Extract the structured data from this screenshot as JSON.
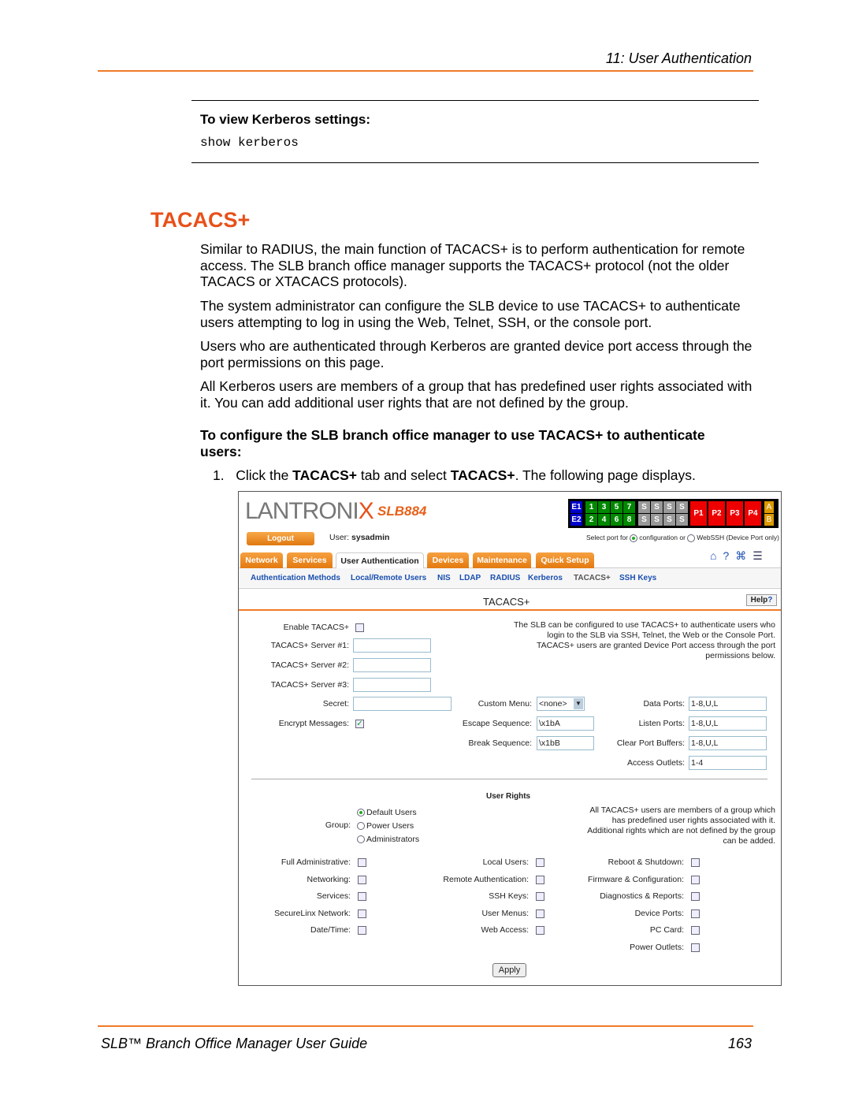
{
  "header": {
    "chapter": "11: User Authentication"
  },
  "command_box": {
    "title": "To view Kerberos settings:",
    "command": "show kerberos"
  },
  "section_title": "TACACS+",
  "paragraphs": [
    "Similar to RADIUS, the main function of TACACS+ is to perform authentication for remote access. The SLB branch office manager supports the TACACS+ protocol (not the older TACACS or XTACACS protocols).",
    "The system administrator can configure the SLB device to use TACACS+ to authenticate users attempting to log in using the Web, Telnet, SSH, or the console port.",
    "Users who are authenticated through Kerberos are granted device port access through the port permissions on this page.",
    "All Kerberos users are members of a group that has predefined user rights associated with it. You can add additional user rights that are not defined by the group."
  ],
  "procedure_heading": "To configure the SLB branch office manager to use TACACS+ to authenticate users:",
  "step": {
    "num": "1.",
    "pre": "Click the ",
    "b1": "TACACS+",
    "mid": " tab and select ",
    "b2": "TACACS+",
    "post": ". The following page displays."
  },
  "ui": {
    "logo": "LANTRONIX",
    "model": "SLB884",
    "ports": {
      "e": [
        "E1",
        "E2"
      ],
      "top": [
        "1",
        "3",
        "5",
        "7"
      ],
      "bottom": [
        "2",
        "4",
        "6",
        "8"
      ],
      "s": "S",
      "p": [
        "P1",
        "P2",
        "P3",
        "P4"
      ],
      "ab": [
        "A",
        "B"
      ]
    },
    "logout": "Logout",
    "user_label": "User:",
    "user": "sysadmin",
    "select_port": "Select port for",
    "opt_config": "configuration",
    "or": "or",
    "opt_webssh": "WebSSH (Device Port only)",
    "tabs": [
      "Network",
      "Services",
      "User Authentication",
      "Devices",
      "Maintenance",
      "Quick Setup"
    ],
    "subtabs": [
      "Authentication Methods",
      "Local/Remote Users",
      "NIS",
      "LDAP",
      "RADIUS",
      "Kerberos",
      "TACACS+",
      "SSH Keys"
    ],
    "page_title": "TACACS+",
    "help": "Help",
    "enable_label": "Enable TACACS+",
    "server1": "TACACS+ Server #1:",
    "server2": "TACACS+ Server #2:",
    "server3": "TACACS+ Server #3:",
    "secret": "Secret:",
    "encrypt": "Encrypt Messages:",
    "intro": "The SLB can be configured to use TACACS+ to authenticate users who login to the SLB via SSH, Telnet, the Web or the Console Port. TACACS+ users are granted Device Port access through the port permissions below.",
    "custom_menu": "Custom Menu:",
    "custom_menu_value": "<none>",
    "escape": "Escape Sequence:",
    "escape_value": "\\x1bA",
    "break": "Break Sequence:",
    "break_value": "\\x1bB",
    "data_ports": "Data Ports:",
    "data_ports_value": "1-8,U,L",
    "listen_ports": "Listen Ports:",
    "listen_ports_value": "1-8,U,L",
    "clear_buffers": "Clear Port Buffers:",
    "clear_buffers_value": "1-8,U,L",
    "access_outlets": "Access Outlets:",
    "access_outlets_value": "1-4",
    "user_rights": "User Rights",
    "group": "Group:",
    "groups": [
      "Default Users",
      "Power Users",
      "Administrators"
    ],
    "group_note": "All TACACS+ users are members of a group which has predefined user rights associated with it. Additional rights which are not defined by the group can be added.",
    "rights_col1": [
      "Full Administrative:",
      "Networking:",
      "Services:",
      "SecureLinx Network:",
      "Date/Time:"
    ],
    "rights_col2": [
      "Local Users:",
      "Remote Authentication:",
      "SSH Keys:",
      "User Menus:",
      "Web Access:"
    ],
    "rights_col3": [
      "Reboot & Shutdown:",
      "Firmware & Configuration:",
      "Diagnostics & Reports:",
      "Device Ports:",
      "PC Card:",
      "Power Outlets:"
    ],
    "apply": "Apply"
  },
  "footer": {
    "title": "SLB™ Branch Office Manager User Guide",
    "page": "163"
  }
}
